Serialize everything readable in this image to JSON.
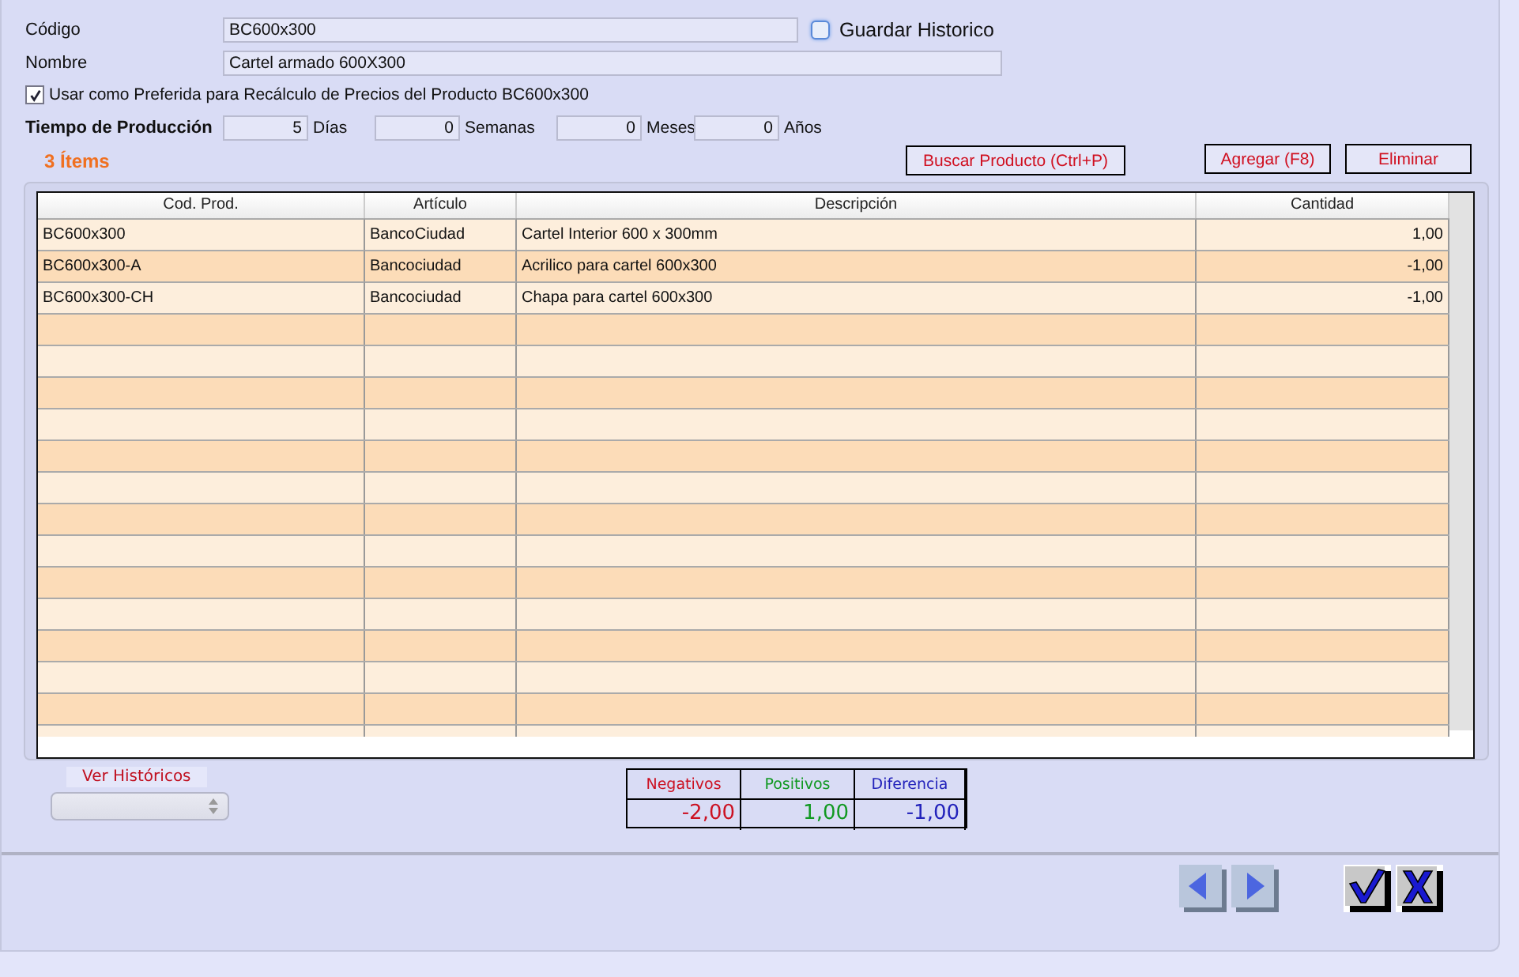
{
  "form": {
    "codigo_label": "Código",
    "codigo": "BC600x300",
    "guardar_historico": {
      "label": "Guardar Historico",
      "checked": false
    },
    "nombre_label": "Nombre",
    "nombre": "Cartel armado 600X300",
    "preferida": {
      "label": "Usar como Preferida para Recálculo de Precios del Producto BC600x300",
      "checked": true
    },
    "tiempo_label": "Tiempo de Producción",
    "tiempo": [
      {
        "value": "5",
        "unit": "Días"
      },
      {
        "value": "0",
        "unit": "Semanas"
      },
      {
        "value": "0",
        "unit": "Meses"
      },
      {
        "value": "0",
        "unit": "Años"
      }
    ]
  },
  "items_count": "3 Ítems",
  "buttons": [
    "Buscar Producto (Ctrl+P)",
    "Agregar (F8)",
    "Eliminar"
  ],
  "table": {
    "columns": [
      "Cod. Prod.",
      "Artículo",
      "Descripción",
      "Cantidad"
    ],
    "rows": [
      [
        "BC600x300",
        "BancoCiudad",
        "Cartel Interior 600 x 300mm",
        "1,00"
      ],
      [
        "BC600x300-A",
        "Bancociudad",
        "Acrilico para cartel 600x300",
        "-1,00"
      ],
      [
        "BC600x300-CH",
        "Bancociudad",
        "Chapa para cartel 600x300",
        "-1,00"
      ]
    ]
  },
  "historicos": {
    "label": "Ver Históricos"
  },
  "totals": [
    {
      "label": "Negativos",
      "value": "-2,00",
      "color": "#cc1122"
    },
    {
      "label": "Positivos",
      "value": "1,00",
      "color": "#119922"
    },
    {
      "label": "Diferencia",
      "value": "-1,00",
      "color": "#2222bb"
    }
  ]
}
